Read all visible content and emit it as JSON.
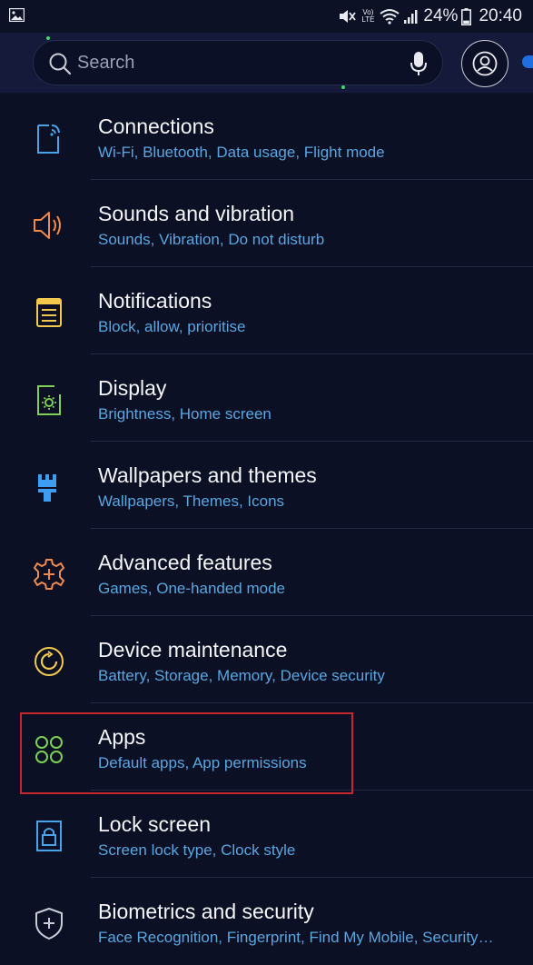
{
  "status_bar": {
    "battery": "24%",
    "time": "20:40",
    "volte_line1": "Vo)",
    "volte_line2": "LTE"
  },
  "search": {
    "placeholder": "Search"
  },
  "settings": [
    {
      "title": "Connections",
      "subtitle": "Wi-Fi, Bluetooth, Data usage, Flight mode",
      "icon": "connections-icon"
    },
    {
      "title": "Sounds and vibration",
      "subtitle": "Sounds, Vibration, Do not disturb",
      "icon": "speaker-icon"
    },
    {
      "title": "Notifications",
      "subtitle": "Block, allow, prioritise",
      "icon": "notifications-icon"
    },
    {
      "title": "Display",
      "subtitle": "Brightness, Home screen",
      "icon": "display-icon"
    },
    {
      "title": "Wallpapers and themes",
      "subtitle": "Wallpapers, Themes, Icons",
      "icon": "paintbrush-icon"
    },
    {
      "title": "Advanced features",
      "subtitle": "Games, One-handed mode",
      "icon": "gear-icon"
    },
    {
      "title": "Device maintenance",
      "subtitle": "Battery, Storage, Memory, Device security",
      "icon": "maintenance-icon"
    },
    {
      "title": "Apps",
      "subtitle": "Default apps, App permissions",
      "icon": "apps-icon"
    },
    {
      "title": "Lock screen",
      "subtitle": "Screen lock type, Clock style",
      "icon": "lock-icon"
    },
    {
      "title": "Biometrics and security",
      "subtitle": "Face Recognition, Fingerprint, Find My Mobile, Security update",
      "icon": "shield-icon"
    }
  ],
  "colors": {
    "background": "#0b1025",
    "subtitle": "#5aa6e0",
    "highlight": "#c9252c"
  }
}
